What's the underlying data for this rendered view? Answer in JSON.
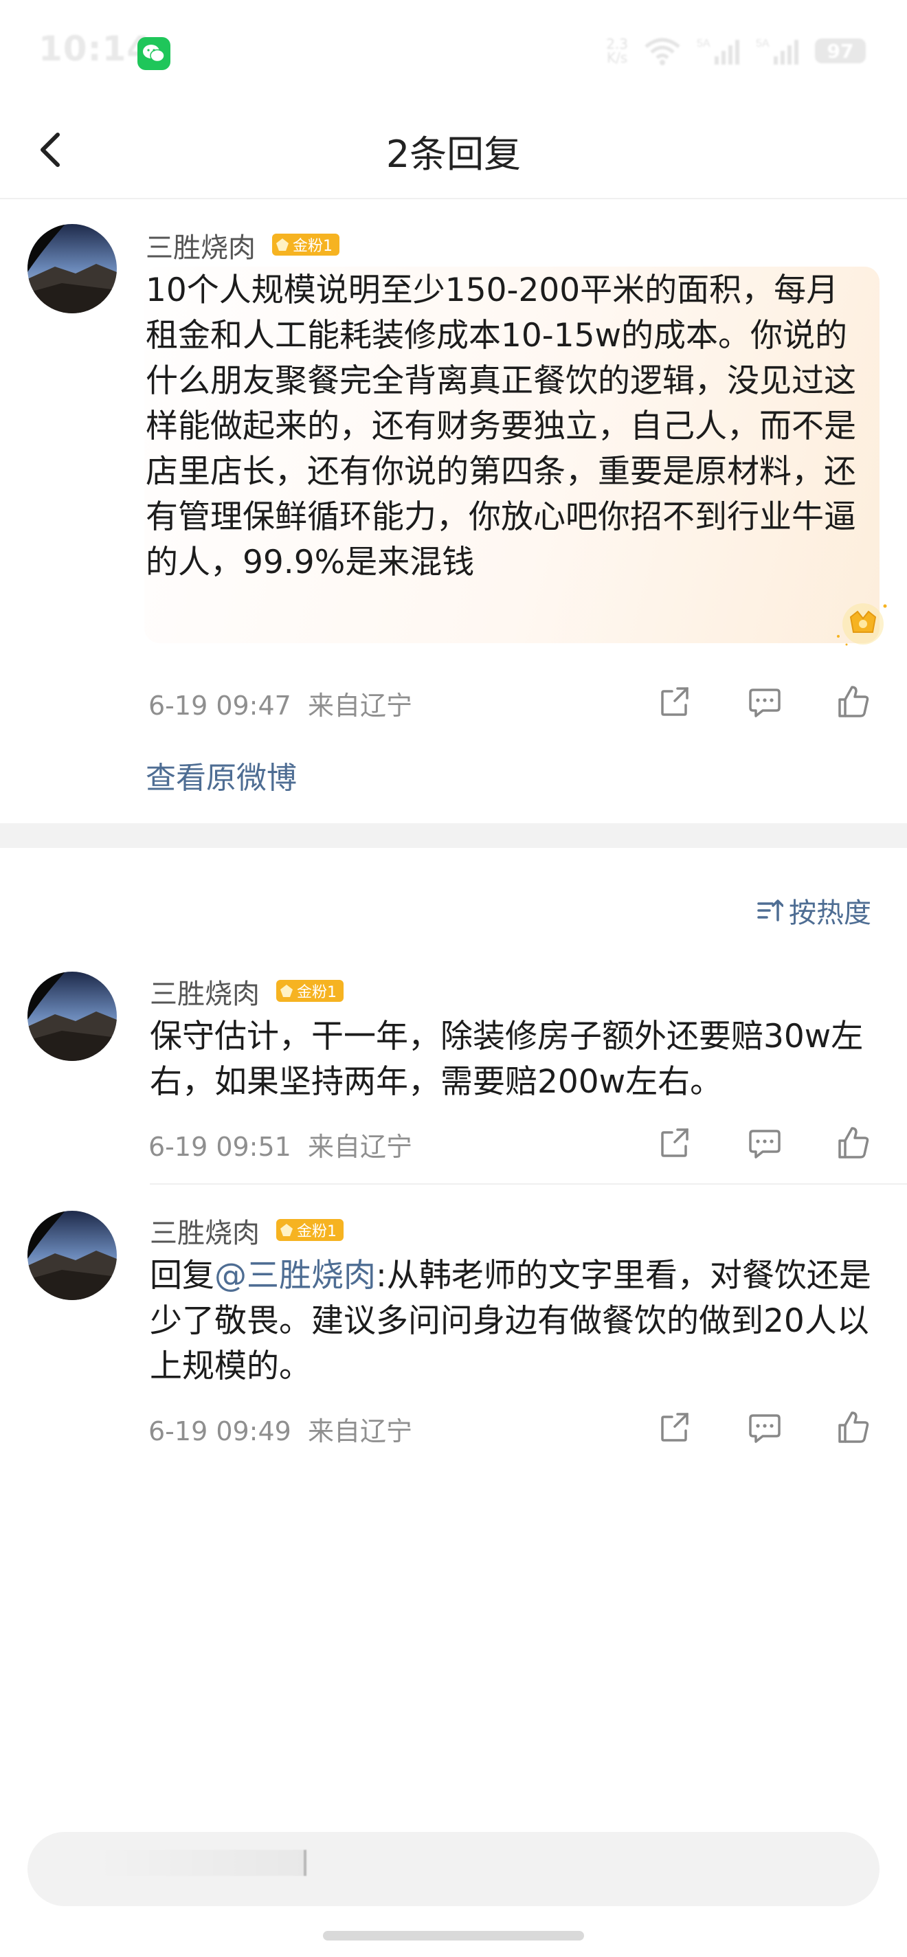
{
  "status_bar": {
    "time": "10:14",
    "net_speed_value": "2.3",
    "net_speed_unit": "K/s",
    "battery": "97",
    "icons": [
      "wechat-icon",
      "wifi-icon",
      "signal-5a-icon",
      "signal-5a-icon"
    ]
  },
  "nav": {
    "title": "2条回复",
    "back_icon": "chevron-left-icon"
  },
  "main_comment": {
    "username": "三胜烧肉",
    "badge": "金粉1",
    "text": "10个人规模说明至少150-200平米的面积，每月租金和人工能耗装修成本10-15w的成本。你说的什么朋友聚餐完全背离真正餐饮的逻辑，没见过这样能做起来的，还有财务要独立，自己人，而不是店里店长，还有你说的第四条，重要是原材料，还有管理保鲜循环能力，你放心吧你招不到行业牛逼的人，99.9%是来混钱",
    "time": "6-19 09:47",
    "location": "来自辽宁",
    "view_original": "查看原微博"
  },
  "sort": {
    "label": "按热度",
    "icon": "sort-icon"
  },
  "replies": [
    {
      "username": "三胜烧肉",
      "badge": "金粉1",
      "text": "保守估计，干一年，除装修房子额外还要赔30w左右，如果坚持两年，需要赔200w左右。",
      "time": "6-19 09:51",
      "location": "来自辽宁"
    },
    {
      "username": "三胜烧肉",
      "badge": "金粉1",
      "prefix": "回复",
      "mention": "@三胜烧肉",
      "text": ":从韩老师的文字里看，对餐饮还是少了敬畏。建议多问问身边有做餐饮的做到20人以上规模的。",
      "time": "6-19 09:49",
      "location": "来自辽宁"
    }
  ],
  "colors": {
    "accent_link": "#4e6d93",
    "badge": "#f6b321",
    "wechat": "#1fc65a"
  }
}
